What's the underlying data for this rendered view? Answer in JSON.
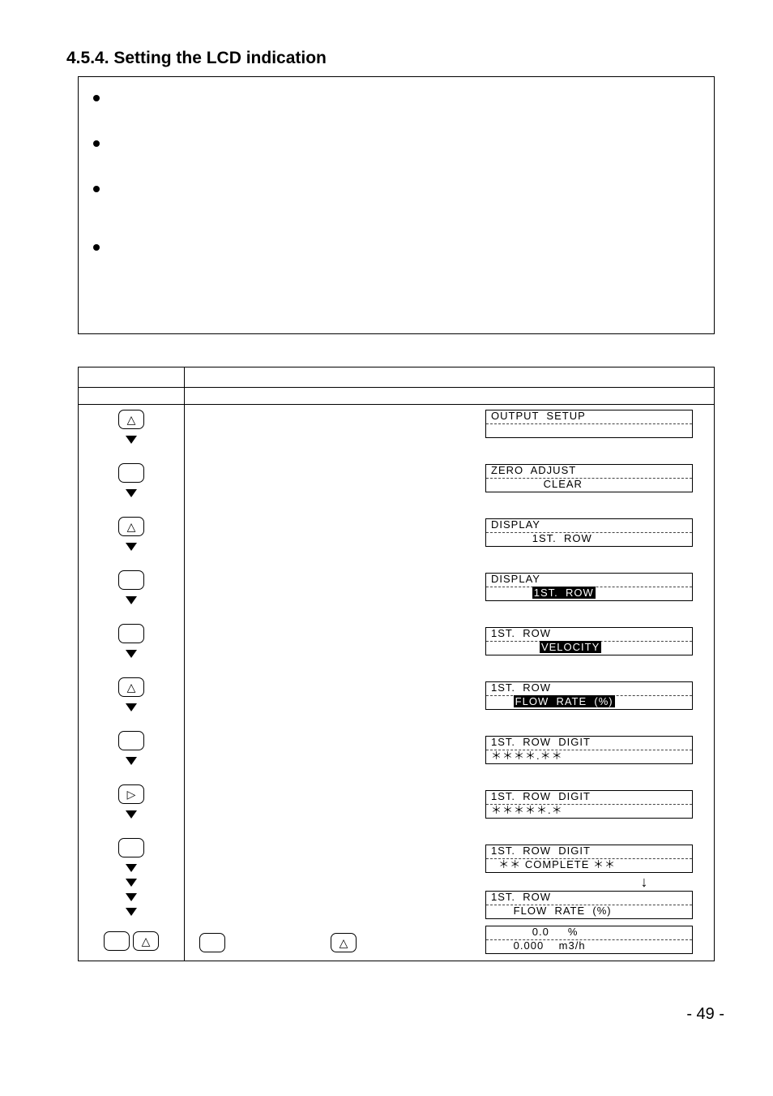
{
  "heading": "4.5.4. Setting the LCD indication",
  "icons": {
    "triangle_up": "△",
    "triangle_right": "▷",
    "blank": " "
  },
  "keys": [
    {
      "glyph": "triangle_up",
      "h": "normal"
    },
    {
      "glyph": "blank",
      "h": "normal"
    },
    {
      "glyph": "triangle_up",
      "h": "normal"
    },
    {
      "glyph": "blank",
      "h": "normal"
    },
    {
      "glyph": "blank",
      "h": "normal"
    },
    {
      "glyph": "triangle_up",
      "h": "normal"
    },
    {
      "glyph": "blank",
      "h": "normal"
    },
    {
      "glyph": "triangle_right",
      "h": "normal"
    },
    {
      "glyph": "blank",
      "h": "tall"
    }
  ],
  "last_key_left": "blank",
  "last_key_right": "triangle_up",
  "mid_left": "blank",
  "mid_right": "triangle_up",
  "lcd": [
    {
      "l1_plain": "OUTPUT  SETUP",
      "l2_inv": "",
      "l2_pre": "",
      "l2_plain": ""
    },
    {
      "l1_plain": "ZERO  ADJUST",
      "l2_pre": "              ",
      "l2_inv": "",
      "l2_plain": "CLEAR"
    },
    {
      "l1_plain": "DISPLAY",
      "l2_pre": "           ",
      "l2_inv": "",
      "l2_plain": "1ST.  ROW"
    },
    {
      "l1_plain": "DISPLAY",
      "l2_pre": "           ",
      "l2_inv": "1ST.  ROW",
      "l2_plain": ""
    },
    {
      "l1_plain": "1ST.  ROW",
      "l2_pre": "             ",
      "l2_inv": "VELOCITY",
      "l2_plain": ""
    },
    {
      "l1_plain": "1ST.  ROW",
      "l2_pre": "      ",
      "l2_inv": "FLOW  RATE  (%)",
      "l2_plain": ""
    },
    {
      "l1_plain": "1ST.  ROW  DIGIT",
      "l2_pre": "",
      "l2_inv": "",
      "l2_plain": "＊＊＊＊.＊＊"
    },
    {
      "l1_plain": "1ST.  ROW  DIGIT",
      "l2_pre": "",
      "l2_inv": "",
      "l2_plain": "＊＊＊＊＊.＊"
    },
    {
      "l1_plain": "1ST.  ROW  DIGIT",
      "l2_pre": "  ",
      "l2_inv": "",
      "l2_plain": "＊＊ COMPLETE ＊＊",
      "nogap": true
    },
    {
      "l1_plain": "1ST.  ROW",
      "l2_pre": "      ",
      "l2_inv": "",
      "l2_plain": "FLOW  RATE  (%)"
    },
    {
      "l1_plain": "           0.0     %",
      "l2_pre": "      ",
      "l2_inv": "",
      "l2_plain": "0.000    m3/h"
    }
  ],
  "down_sym": "↓",
  "page_no": "- 49 -"
}
